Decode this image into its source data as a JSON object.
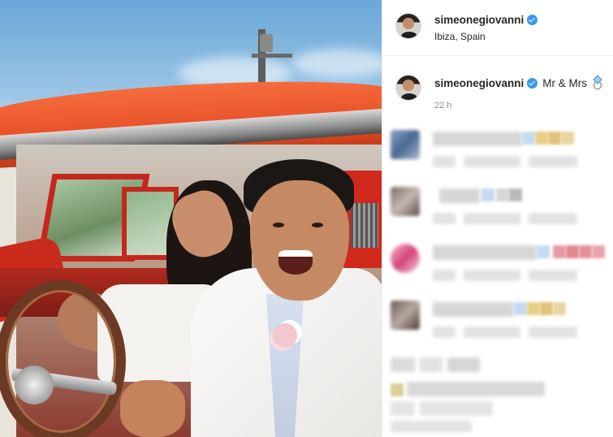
{
  "post": {
    "author": {
      "username": "simeonegiovanni",
      "verified": true,
      "location": "Ibiza, Spain"
    },
    "caption": {
      "username": "simeonegiovanni",
      "text": "Mr & Mrs",
      "emoji_icon": "ring-icon",
      "time": "22 h"
    }
  },
  "comments": {
    "count_visible": 5,
    "content": "blurred"
  },
  "colors": {
    "verified_badge": "#3897f0",
    "text_primary": "#262626",
    "text_secondary": "#8e8e8e",
    "divider": "#efefef"
  }
}
